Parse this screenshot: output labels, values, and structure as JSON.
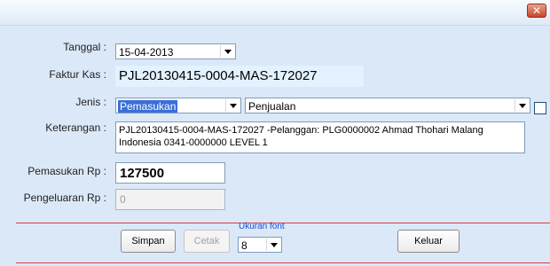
{
  "window": {
    "close_glyph": "✕"
  },
  "form": {
    "tanggal_label": "Tanggal :",
    "tanggal_value": "15-04-2013",
    "faktur_label": "Faktur Kas :",
    "faktur_value": "PJL20130415-0004-MAS-172027",
    "jenis_label": "Jenis :",
    "jenis_value": "Pemasukan",
    "jenis2_value": "Penjualan",
    "keterangan_label": "Keterangan :",
    "keterangan_value": "PJL20130415-0004-MAS-172027 -Pelanggan: PLG0000002 Ahmad Thohari Malang Indonesia 0341-0000000 LEVEL 1",
    "pemasukan_label": "Pemasukan Rp :",
    "pemasukan_value": "127500",
    "pengeluaran_label": "Pengeluaran Rp :",
    "pengeluaran_value": "0"
  },
  "actions": {
    "simpan_label": "Simpan",
    "cetak_label": "Cetak",
    "ukuran_font_label": "Ukuran font",
    "ukuran_font_value": "8",
    "keluar_label": "Keluar"
  }
}
